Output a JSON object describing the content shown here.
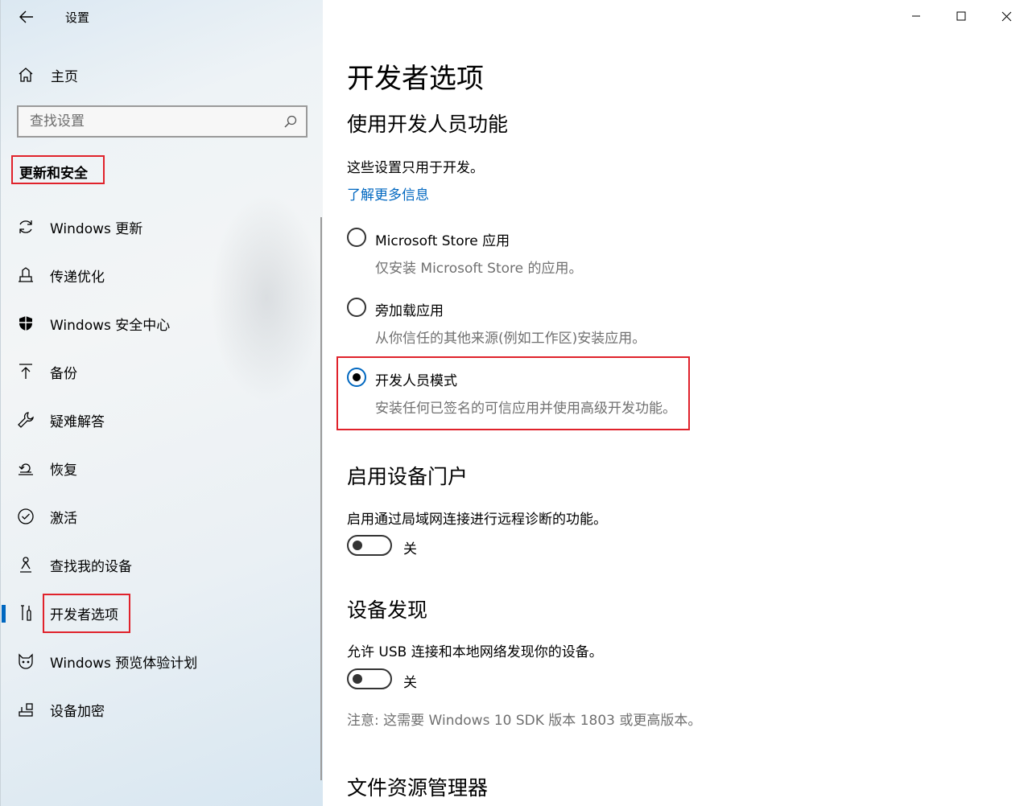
{
  "window": {
    "title": "设置",
    "controls": [
      "minimize-icon",
      "maximize-icon",
      "close-icon"
    ]
  },
  "sidebar": {
    "home_label": "主页",
    "search_placeholder": "查找设置",
    "section_title": "更新和安全",
    "items": [
      {
        "label": "Windows 更新",
        "icon": "refresh-icon"
      },
      {
        "label": "传递优化",
        "icon": "delivery-optimization-icon"
      },
      {
        "label": "Windows 安全中心",
        "icon": "shield-icon"
      },
      {
        "label": "备份",
        "icon": "backup-arrow-icon"
      },
      {
        "label": "疑难解答",
        "icon": "wrench-icon"
      },
      {
        "label": "恢复",
        "icon": "recovery-icon"
      },
      {
        "label": "激活",
        "icon": "check-circle-icon"
      },
      {
        "label": "查找我的设备",
        "icon": "person-location-icon"
      },
      {
        "label": "开发者选项",
        "icon": "developer-tools-icon",
        "selected": true
      },
      {
        "label": "Windows 预览体验计划",
        "icon": "insider-cat-icon"
      },
      {
        "label": "设备加密",
        "icon": "device-encryption-icon"
      }
    ]
  },
  "main": {
    "title": "开发者选项",
    "dev_features": {
      "heading": "使用开发人员功能",
      "desc": "这些设置只用于开发。",
      "link": "了解更多信息",
      "options": [
        {
          "label": "Microsoft Store 应用",
          "desc": "仅安装 Microsoft Store 的应用。",
          "checked": false
        },
        {
          "label": "旁加载应用",
          "desc": "从你信任的其他来源(例如工作区)安装应用。",
          "checked": false
        },
        {
          "label": "开发人员模式",
          "desc": "安装任何已签名的可信应用并使用高级开发功能。",
          "checked": true
        }
      ]
    },
    "device_portal": {
      "heading": "启用设备门户",
      "desc": "启用通过局域网连接进行远程诊断的功能。",
      "toggle_label": "关"
    },
    "device_discovery": {
      "heading": "设备发现",
      "desc": "允许 USB 连接和本地网络发现你的设备。",
      "toggle_label": "关",
      "note": "注意: 这需要 Windows 10 SDK 版本 1803 或更高版本。"
    },
    "file_explorer": {
      "heading": "文件资源管理器"
    }
  },
  "colors": {
    "accent": "#0067c0",
    "highlight_box": "#e0222b"
  }
}
